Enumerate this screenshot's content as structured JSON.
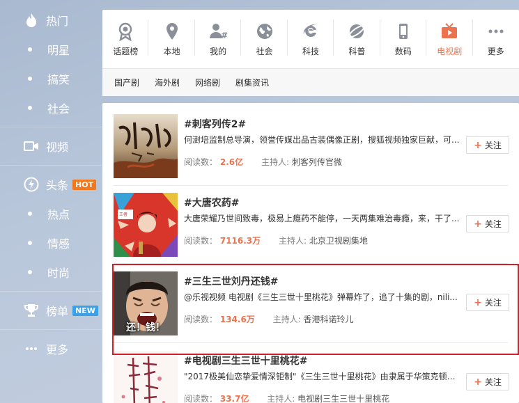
{
  "sidebar": {
    "items": [
      {
        "label": "热门",
        "icon": "flame-icon"
      },
      {
        "label": "明星"
      },
      {
        "label": "搞笑"
      },
      {
        "label": "社会"
      },
      {
        "label": "视频",
        "icon": "video-camera-icon"
      },
      {
        "label": "头条",
        "icon": "lightning-icon",
        "badge": "HOT"
      },
      {
        "label": "热点"
      },
      {
        "label": "情感"
      },
      {
        "label": "时尚"
      },
      {
        "label": "榜单",
        "icon": "trophy-icon",
        "badge": "NEW"
      },
      {
        "label": "更多",
        "icon": "ellipsis-icon"
      }
    ]
  },
  "categories": [
    {
      "label": "话题榜",
      "icon": "medal-icon"
    },
    {
      "label": "本地",
      "icon": "location-pin-icon"
    },
    {
      "label": "我的",
      "icon": "user-hashtag-icon"
    },
    {
      "label": "社会",
      "icon": "globe-icon"
    },
    {
      "label": "科技",
      "icon": "ie-browser-icon"
    },
    {
      "label": "科普",
      "icon": "satellite-icon"
    },
    {
      "label": "数码",
      "icon": "phone-icon"
    },
    {
      "label": "电视剧",
      "icon": "tv-icon",
      "active": true
    },
    {
      "label": "更多",
      "icon": "more-dots-icon"
    }
  ],
  "sub_tabs": [
    "国产剧",
    "海外剧",
    "网络剧",
    "剧集资讯"
  ],
  "topics": [
    {
      "title": "#刺客列传2#",
      "desc": "何澍培监制总导演，领誉传媒出品古装偶像正剧，搜狐视频独家巨献，可...",
      "reads_label": "阅读数：",
      "reads": "2.6亿",
      "host_label": "主持人:",
      "host": "刺客列传官微",
      "follow": "关注"
    },
    {
      "title": "#大唐农药#",
      "desc": "大唐荣耀乃世间致毒，极易上瘾药不能停，一天两集难治毒瘾，来，干了...",
      "reads_label": "阅读数：",
      "reads": "7116.3万",
      "host_label": "主持人:",
      "host": "北京卫视剧集地",
      "follow": "关注"
    },
    {
      "title": "#三生三世刘丹还钱#",
      "desc": "@乐视视频 电视剧《三生三世十里桃花》弹幕炸了，追了十集的剧，nili...",
      "reads_label": "阅读数：",
      "reads": "134.6万",
      "host_label": "主持人:",
      "host": "香港科诺玲儿",
      "follow": "关注",
      "thumb_text": "还！钱！"
    },
    {
      "title": "#电视剧三生三世十里桃花#",
      "desc": "\"2017极美仙恋挚爱情深钜制\"《三生三世十里桃花》由隶属于华策克顿集...",
      "reads_label": "阅读数：",
      "reads": "33.7亿",
      "host_label": "主持人:",
      "host": "电视剧三生三世十里桃花",
      "follow": "关注"
    }
  ],
  "colors": {
    "accent": "#eb7350",
    "highlight": "#d0202a",
    "hot": "#f0781e",
    "new": "#3aa0e8"
  }
}
